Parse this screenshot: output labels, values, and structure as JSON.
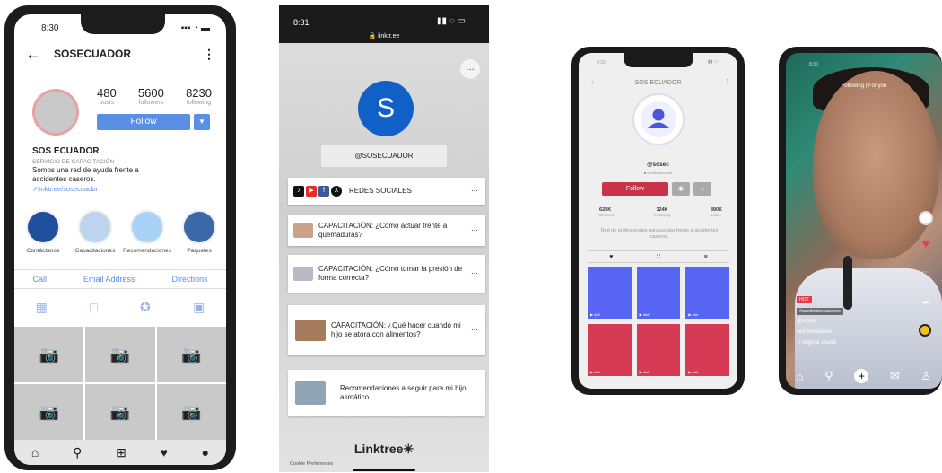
{
  "instagram": {
    "time": "8:30",
    "signal": "▪▪▪ ◔ ▬",
    "username": "SOSECUADOR",
    "stats": [
      {
        "value": "480",
        "label": "posts"
      },
      {
        "value": "5600",
        "label": "followers"
      },
      {
        "value": "8230",
        "label": "following"
      }
    ],
    "follow_label": "Follow",
    "name": "SOS ECUADOR",
    "category": "SERVICIO DE CAPACITACIÓN",
    "bio": "Somos una red de ayuda frente a accidentes caseros.",
    "link": "↗linktr.ee/sosecuador",
    "highlights": [
      {
        "label": "Contáctanos",
        "color": "#1e4e9c"
      },
      {
        "label": "Capacitaciones",
        "color": "#bcd4ee"
      },
      {
        "label": "Recomendaciones",
        "color": "#a9d3f6"
      },
      {
        "label": "Paquetes",
        "color": "#3b68a8"
      }
    ],
    "actions": [
      "Call",
      "Email Address",
      "Directions"
    ]
  },
  "linktree": {
    "time": "8:31",
    "url": "🔒 linktr.ee",
    "avatar_letter": "S",
    "username": "@SOSECUADOR",
    "links": [
      {
        "text": "REDES SOCIALES"
      },
      {
        "text": "CAPACITACIÓN: ¿Cómo actuar frente a quemaduras?"
      },
      {
        "text": "CAPACITACIÓN: ¿Cómo tomar la presión de forma correcta?"
      },
      {
        "text": "CAPACITACIÓN: ¿Qué hacer cuando mi hijo se atora con alimentos?"
      },
      {
        "text": "Recomendaciones a seguir para mi hijo asmático."
      }
    ],
    "menu_dots": "…",
    "logo": "Linktree✳",
    "cookie": "Cookie Preferences"
  },
  "tiktok_profile": {
    "time": "8:30",
    "title": "SOS ECUADOR",
    "handle": "@sosec",
    "verified": "verified account",
    "follow_label": "Follow",
    "stats": [
      {
        "value": "625K",
        "label": "Followers"
      },
      {
        "value": "124K",
        "label": "Following"
      },
      {
        "value": "890K",
        "label": "Likes"
      }
    ],
    "bio": "Red de profesionales para ayudar frente a accidentes caseros.",
    "video_counts": [
      "▶ ###",
      "▶ ###",
      "▶ ###",
      "▶ ###",
      "▶ ###",
      "▶ ###"
    ],
    "colors": {
      "blue": "#5865f2",
      "red": "#d63a55"
    }
  },
  "tiktok_video": {
    "time": "8:30",
    "tabs": "Following  |  For you",
    "hot": "HOT",
    "tag": "#accidentes caseros",
    "user": "@sosec",
    "translation": "see translation",
    "sound": "♫ original sound"
  }
}
